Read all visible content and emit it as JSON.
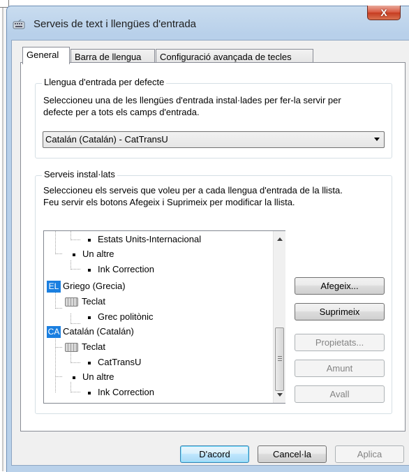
{
  "window": {
    "title": "Serveis de text i llengües d'entrada",
    "close_label": "X"
  },
  "tabs": [
    "General",
    "Barra de llengua",
    "Configuració avançada de tecles"
  ],
  "default_lang": {
    "group_label": "Llengua d'entrada per defecte",
    "description_line1": "Seleccioneu una de les llengües d'entrada instal·lades per fer-la servir per",
    "description_line2": "defecte per a tots els camps d'entrada.",
    "selected": "Catalán (Catalán) - CatTransU"
  },
  "services": {
    "group_label": "Serveis instal·lats",
    "description_line1": "Seleccioneu els serveis que voleu per a cada llengua d'entrada de la llista.",
    "description_line2": "Feu servir els botons Afegeix i Suprimeix per modificar la llista.",
    "tree": [
      {
        "text": "Estats Units-Internacional",
        "type": "item"
      },
      {
        "text": "Un altre",
        "type": "group"
      },
      {
        "text": "Ink Correction",
        "type": "item"
      },
      {
        "text": "Griego (Grecia)",
        "type": "lang",
        "badge": "EL"
      },
      {
        "text": "Teclat",
        "type": "kbd"
      },
      {
        "text": "Grec politònic",
        "type": "item"
      },
      {
        "text": "Catalán (Catalán)",
        "type": "lang",
        "badge": "CA"
      },
      {
        "text": "Teclat",
        "type": "kbd"
      },
      {
        "text": "CatTransU",
        "type": "item"
      },
      {
        "text": "Un altre",
        "type": "group"
      },
      {
        "text": "Ink Correction",
        "type": "item"
      }
    ],
    "buttons": {
      "add": "Afegeix...",
      "remove": "Suprimeix",
      "properties": "Propietats...",
      "up": "Amunt",
      "down": "Avall"
    }
  },
  "footer": {
    "ok": "D'acord",
    "cancel": "Cancel·la",
    "apply": "Aplica"
  },
  "colors": {
    "lang_badge": "#1a7fe0",
    "close_button": "#c53c21"
  }
}
